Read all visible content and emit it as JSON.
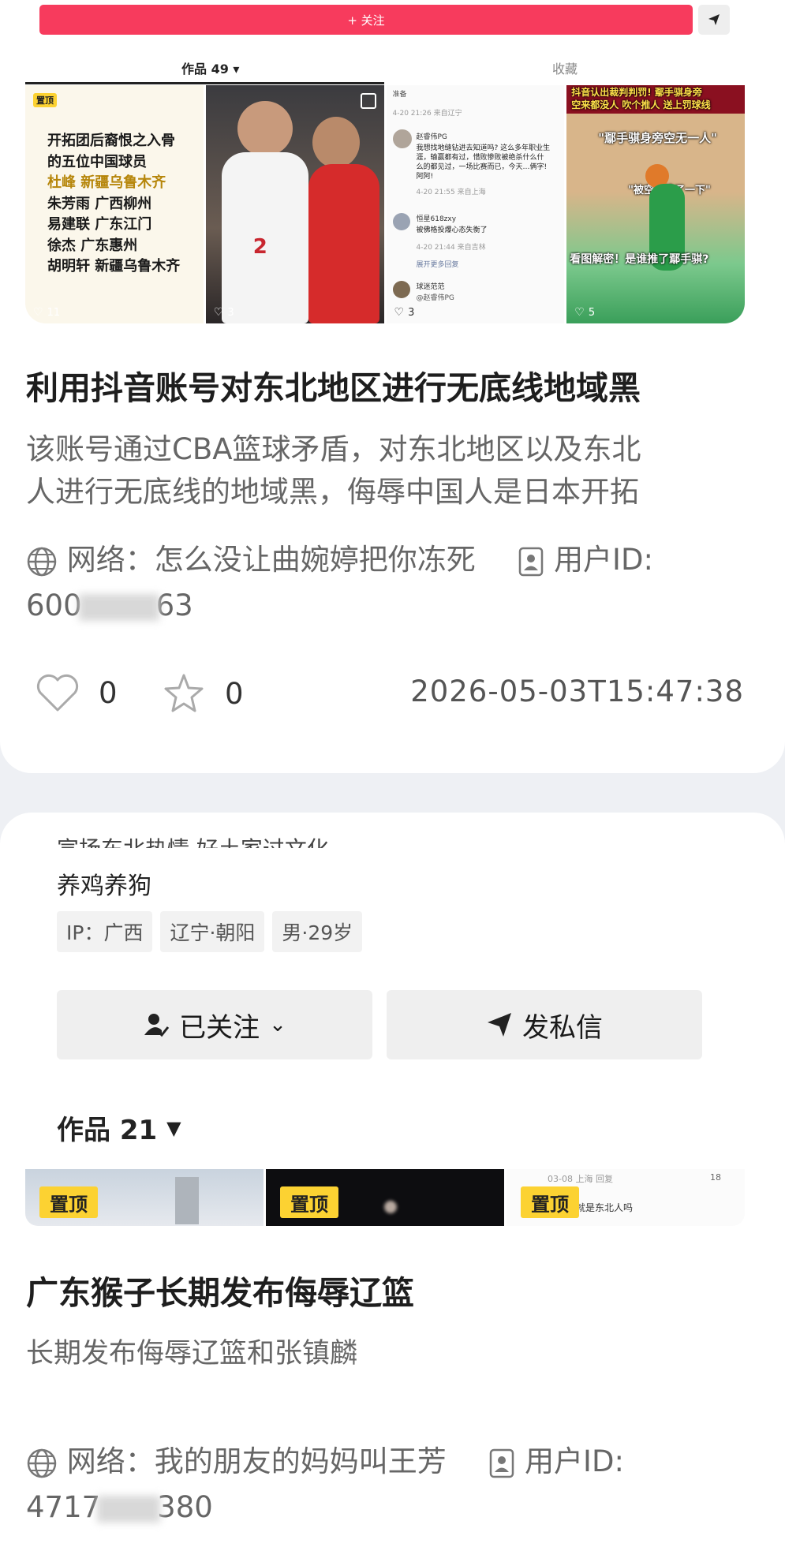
{
  "card1": {
    "follow_label": "+ 关注",
    "tabs": [
      "作品 49 ▾",
      "收藏"
    ],
    "thumbs": [
      {
        "badge": "置顶",
        "likes": "11",
        "lines": [
          "开拓团后裔恨之入骨",
          "的五位中国球员",
          "杜峰 新疆乌鲁木齐",
          "朱芳雨 广西柳州",
          "易建联 广东江门",
          "徐杰 广东惠州",
          "胡明轩 新疆乌鲁木齐"
        ]
      },
      {
        "likes": "3"
      },
      {
        "likes": "3",
        "lines": [
          "准备",
          "4-20 21:26 来自辽宁",
          "赵睿伟PG",
          "我想找地缝钻进去知道吗? 这么多年职业生涯，输赢都有过，惜败惨败被绝杀什么什么的都见过，一场比赛而已，今天…俩字! 阿阿!",
          "4-20 21:55 来自上海",
          "恒星618zxy",
          "被佛格投爆心态失衡了",
          "4-20 21:44 来自吉林",
          "展开更多回复",
          "球迷范范",
          "@赵睿伟PG"
        ]
      },
      {
        "likes": "5",
        "captions": [
          "抖音认出裁判判罚! 鄢手骐身旁",
          "空来都没人 吹个推人 送上罚球线",
          "\"鄢手骐身旁空无一人\"",
          "\"被空气推了一下\"",
          "看图解密！是谁推了鄢手骐?"
        ]
      }
    ],
    "title": "利用抖音账号对东北地区进行无底线地域黑",
    "desc_line1": "该账号通过CBA篮球矛盾，对东北地区以及东北",
    "desc_line2": "人进行无底线的地域黑，侮辱中国人是日本开拓",
    "net_label": "网络：怎么没让曲婉婷把你冻死",
    "uid_label": "用户ID:",
    "uid_prefix": "600",
    "uid_suffix": "63",
    "likes": "0",
    "stars": "0",
    "timestamp": "2026-05-03T15:47:38"
  },
  "card2": {
    "bio_cut": "宣扬东北热情 好土家过文化",
    "bio": "养鸡养狗",
    "tags": [
      "IP：广西",
      "辽宁·朝阳",
      "男·29岁"
    ],
    "followed_label": "已关注",
    "message_label": "发私信",
    "works_label": "作品 21",
    "badges": [
      "置顶",
      "置顶",
      "置顶"
    ],
    "thumb3_text": [
      "03-08  上海  回复",
      "18",
      "自己不就是东北人吗"
    ],
    "title": "广东猴子长期发布侮辱辽篮",
    "desc": "长期发布侮辱辽篮和张镇麟",
    "net_label": "网络：我的朋友的妈妈叫王芳",
    "uid_label": "用户ID:",
    "uid_prefix": "4717",
    "uid_suffix": "380"
  }
}
